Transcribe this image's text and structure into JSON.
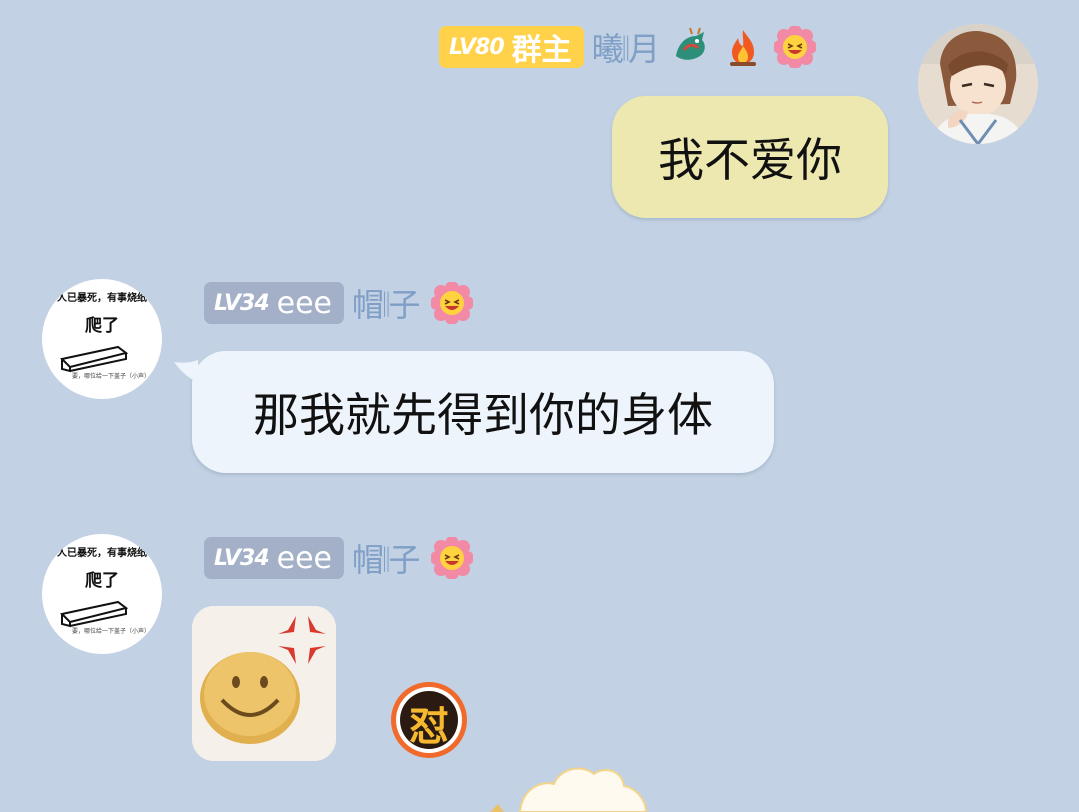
{
  "messages": [
    {
      "level": "LV80",
      "title": "群主",
      "nickname": "曦𝄁月",
      "text": "我不爱你",
      "avatar": "anime-girl-avatar"
    },
    {
      "level": "LV34",
      "title": "eee",
      "nickname": "帽𝄁子",
      "text": "那我就先得到你的身体",
      "avatar_text": [
        "人已暴死，有事烧纸",
        "爬了",
        "要，哪位给一下盖子（小声）"
      ]
    },
    {
      "level": "LV34",
      "title": "eee",
      "nickname": "帽𝄁子",
      "sticker": "angry-smiley-sticker",
      "reaction": "怼",
      "avatar_text": [
        "人已暴死，有事烧纸",
        "爬了",
        "要，哪位给一下盖子（小声）"
      ]
    }
  ],
  "icons": [
    "dragon-icon",
    "fire-icon",
    "laughing-flower-icon"
  ],
  "colors": {
    "background": "#c2d1e3",
    "owner_badge": "#ffd24a",
    "member_badge": "#a3b0c7",
    "nickname": "#7f9fc6",
    "my_bubble": "#ece8b0",
    "other_bubble": "#eef4fc"
  }
}
